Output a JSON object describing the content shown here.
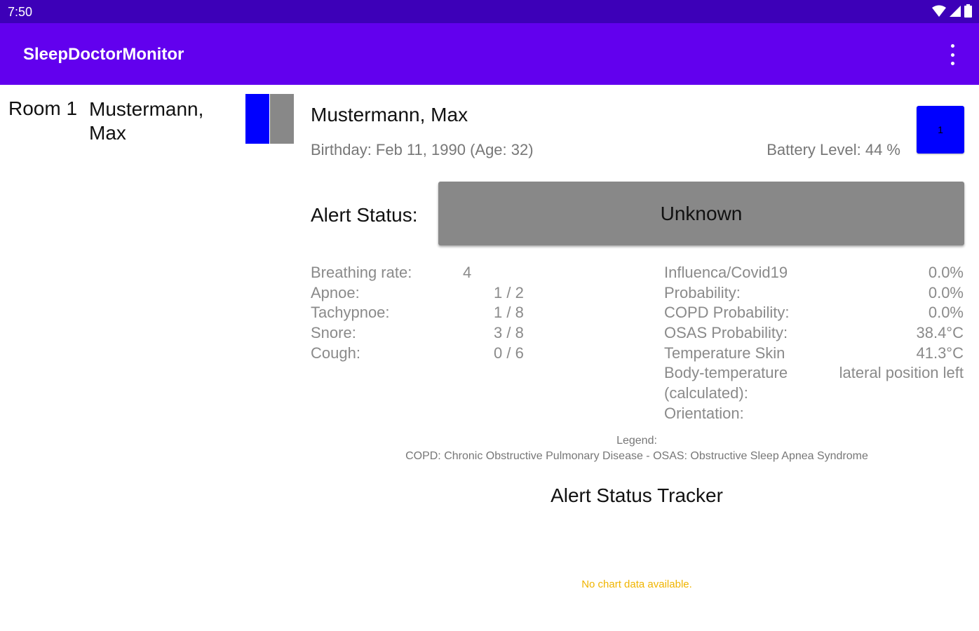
{
  "status_bar": {
    "time": "7:50"
  },
  "app_bar": {
    "title": "SleepDoctorMonitor"
  },
  "patient_list": [
    {
      "room": "Room 1",
      "name": "Mustermann, Max"
    }
  ],
  "detail": {
    "name": "Mustermann, Max",
    "birthday": "Birthday: Feb 11, 1990 (Age: 32)",
    "battery": "Battery Level: 44 %",
    "badge": "1",
    "alert_label": "Alert Status:",
    "alert_value": "Unknown"
  },
  "metrics_left": {
    "labels": [
      "Breathing rate:",
      "Apnoe:",
      "Tachypnoe:",
      "Snore:",
      "Cough:"
    ],
    "values": [
      "4",
      "1 / 2",
      "1 / 8",
      "3 / 8",
      "0 / 6"
    ]
  },
  "metrics_right": {
    "labels": [
      "Influenca/Covid19",
      "Probability:",
      "COPD Probability:",
      "OSAS Probability:",
      "Temperature Skin",
      "Body-temperature",
      "(calculated):",
      "Orientation:"
    ],
    "values": [
      "0.0%",
      "0.0%",
      "0.0%",
      "38.4°C",
      "41.3°C",
      "lateral position left"
    ]
  },
  "legend": {
    "title": "Legend:",
    "text": "COPD: Chronic Obstructive Pulmonary Disease - OSAS: Obstructive Sleep Apnea Syndrome"
  },
  "tracker": {
    "title": "Alert Status Tracker",
    "no_data": "No chart data available."
  },
  "colors": {
    "status_bar": "#3d00b8",
    "app_bar": "#6200ee",
    "indicator_blue": "#0000ff",
    "indicator_gray": "#888888",
    "alert_unknown": "#888888",
    "no_data_text": "#f0b400"
  }
}
